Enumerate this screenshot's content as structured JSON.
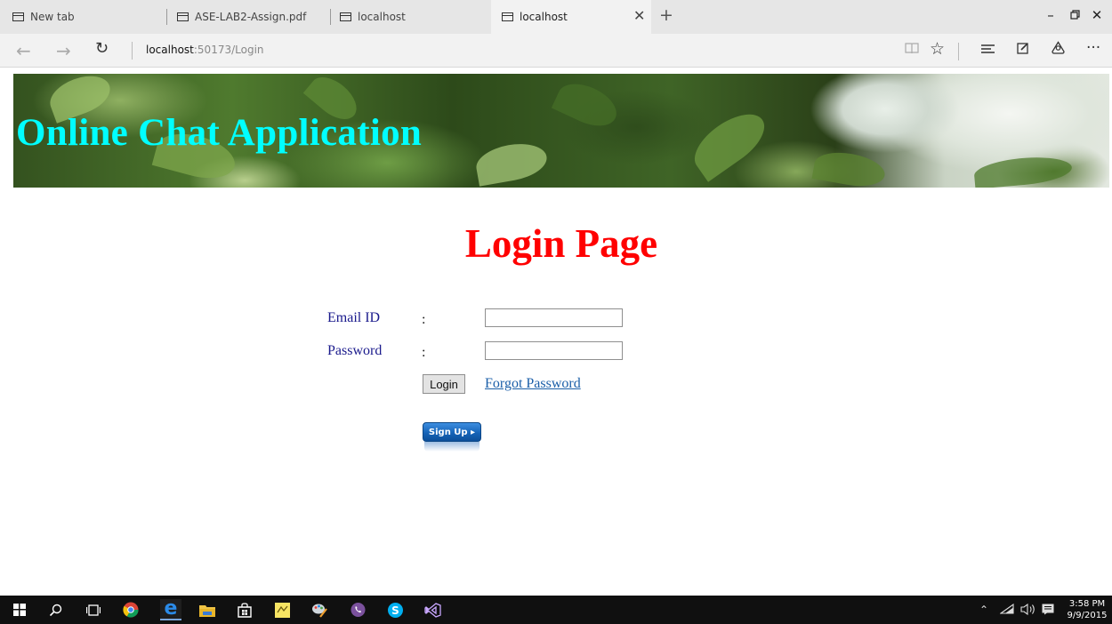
{
  "browser": {
    "tabs": [
      {
        "title": "New tab",
        "active": false
      },
      {
        "title": "ASE-LAB2-Assign.pdf",
        "active": false
      },
      {
        "title": "localhost",
        "active": false
      },
      {
        "title": "localhost",
        "active": true
      }
    ],
    "new_tab_icon": "plus-icon",
    "address": {
      "host": "localhost",
      "path": ":50173/Login"
    },
    "window_controls": [
      "minimize-icon",
      "restore-icon",
      "close-icon"
    ],
    "toolbar_icons": [
      "reading-view-icon",
      "favorite-star-icon",
      "hub-icon",
      "web-note-icon",
      "share-icon",
      "more-icon"
    ]
  },
  "page": {
    "banner_title": "Online Chat Application",
    "heading": "Login Page",
    "form": {
      "email_label": "Email ID",
      "password_label": "Password",
      "colon": ":",
      "email_value": "",
      "password_value": "",
      "login_label": "Login",
      "forgot_label": "Forgot Password",
      "signup_label": "Sign Up ▸"
    },
    "colors": {
      "banner_title": "#00ffff",
      "heading": "#ff0000",
      "label": "#1a1a8c",
      "link": "#1a5ea8"
    }
  },
  "taskbar": {
    "apps": [
      "start-icon",
      "search-icon",
      "task-view-icon",
      "chrome-icon",
      "edge-icon",
      "file-explorer-icon",
      "store-icon",
      "sticky-notes-icon",
      "paint-icon",
      "viber-icon",
      "skype-icon",
      "visual-studio-icon"
    ],
    "tray_icons": [
      "show-hidden-icon",
      "wifi-icon",
      "volume-icon",
      "notifications-icon"
    ],
    "time": "3:58 PM",
    "date": "9/9/2015"
  }
}
